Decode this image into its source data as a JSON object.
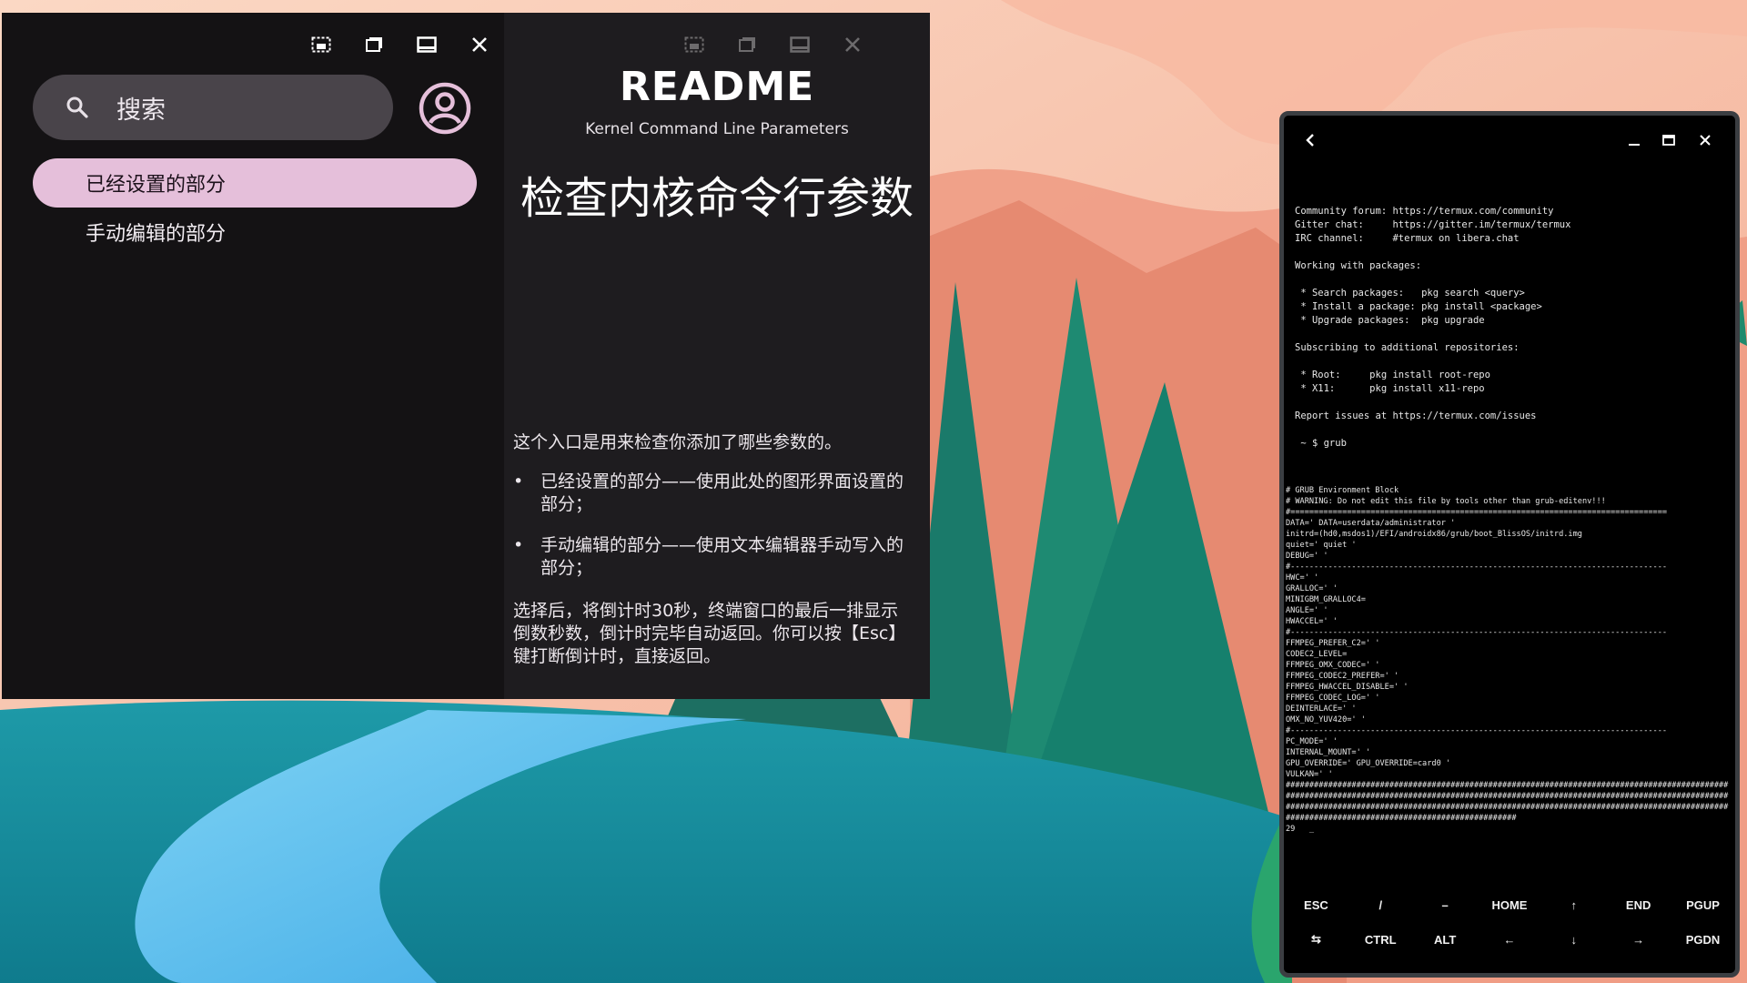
{
  "settings_window": {
    "titlebar_left_buttons": [
      "minimize-icon",
      "restore-icon",
      "maximize-icon",
      "close-icon"
    ],
    "titlebar_right_buttons": [
      "minimize-icon",
      "restore-icon",
      "maximize-icon",
      "close-icon"
    ],
    "search": {
      "icon": "search-icon",
      "text": "搜索"
    },
    "avatar_icon": "account-icon",
    "nav": {
      "items": [
        {
          "label": "已经设置的部分",
          "active": true
        },
        {
          "label": "手动编辑的部分",
          "active": false
        }
      ]
    },
    "readme": {
      "title": "README",
      "subtitle": "Kernel Command Line Parameters",
      "heading": "检查内核命令行参数",
      "intro": "这个入口是用来检查你添加了哪些参数的。",
      "bullets": [
        "已经设置的部分——使用此处的图形界面设置的部分；",
        "手动编辑的部分——使用文本编辑器手动写入的部分；"
      ],
      "outro": "选择后，将倒计时30秒，终端窗口的最后一排显示倒数秒数，倒计时完毕自动返回。你可以按【Esc】键打断倒计时，直接返回。"
    },
    "colors": {
      "left_bg": "#141214",
      "right_bg": "#1e1c1f",
      "accent": "#e5bfda",
      "search_bg": "#49444a"
    }
  },
  "terminal": {
    "titlebar_icons": [
      "back-icon",
      "minimize-icon",
      "maximize-icon",
      "close-icon"
    ],
    "welcome_lines": [
      "Community forum: https://termux.com/community",
      "Gitter chat:     https://gitter.im/termux/termux",
      "IRC channel:     #termux on libera.chat",
      "",
      "Working with packages:",
      "",
      " * Search packages:   pkg search <query>",
      " * Install a package: pkg install <package>",
      " * Upgrade packages:  pkg upgrade",
      "",
      "Subscribing to additional repositories:",
      "",
      " * Root:     pkg install root-repo",
      " * X11:      pkg install x11-repo",
      "",
      "Report issues at https://termux.com/issues",
      "",
      " ~ $ grub"
    ],
    "output_lines": [
      "# GRUB Environment Block",
      "# WARNING: Do not edit this file by tools other than grub-editenv!!!",
      "#================================================================================",
      "DATA=' DATA=userdata/administrator '",
      "initrd=(hd0,msdos1)/EFI/androidx86/grub/boot_BlissOS/initrd.img",
      "quiet=' quiet '",
      "DEBUG=' '",
      "#--------------------------------------------------------------------------------",
      "HWC=' '",
      "GRALLOC=' '",
      "MINIGBM_GRALLOC4=",
      "ANGLE=' '",
      "HWACCEL=' '",
      "#--------------------------------------------------------------------------------",
      "FFMPEG_PREFER_C2=' '",
      "CODEC2_LEVEL=",
      "FFMPEG_OMX_CODEC=' '",
      "FFMPEG_CODEC2_PREFER=' '",
      "FFMPEG_HWACCEL_DISABLE=' '",
      "FFMPEG_CODEC_LOG=' '",
      "DEINTERLACE=' '",
      "OMX_NO_YUV420=' '",
      "#--------------------------------------------------------------------------------",
      "PC_MODE=' '",
      "INTERNAL_MOUNT=' '",
      "GPU_OVERRIDE=' GPU_OVERRIDE=card0 '",
      "VULKAN=' '",
      "##############################################################################################",
      "##############################################################################################",
      "##############################################################################################",
      "#################################################",
      "29   _"
    ],
    "keys_row1": [
      "ESC",
      "/",
      "–",
      "HOME",
      "↑",
      "END",
      "PGUP"
    ],
    "keys_row2": [
      "⇆",
      "CTRL",
      "ALT",
      "←",
      "↓",
      "→",
      "PGDN"
    ]
  }
}
